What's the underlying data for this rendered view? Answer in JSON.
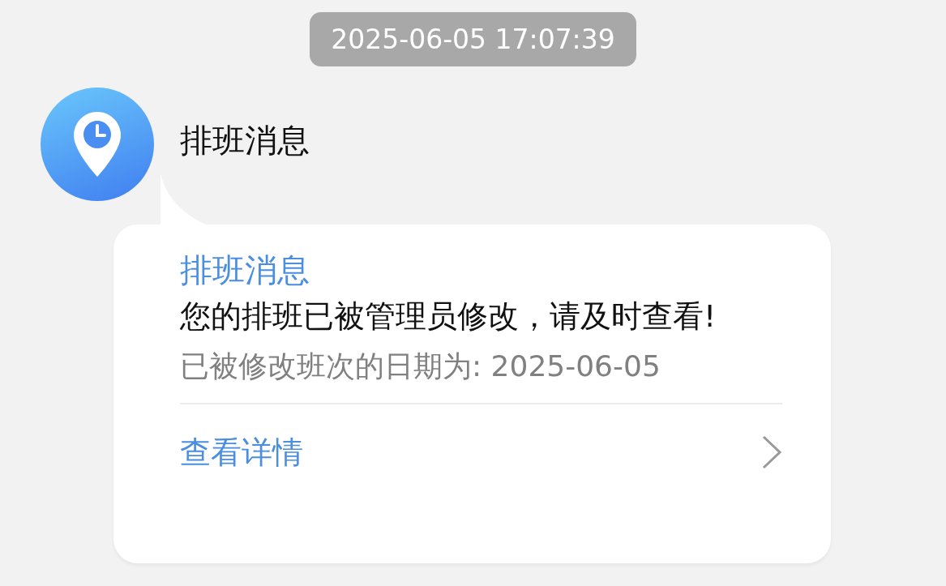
{
  "timestamp": "2025-06-05 17:07:39",
  "sender": {
    "name": "排班消息"
  },
  "message": {
    "title": "排班消息",
    "body": "您的排班已被管理员修改，请及时查看!",
    "detail": "已被修改班次的日期为: 2025-06-05",
    "link": "查看详情"
  }
}
